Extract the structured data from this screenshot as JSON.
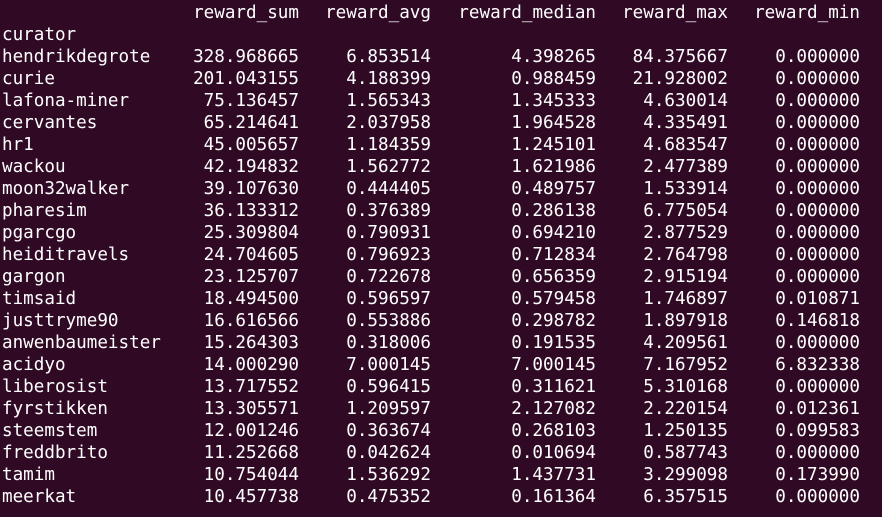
{
  "terminal": {
    "top_cut_text": "-----",
    "columns": [
      "reward_sum",
      "reward_avg",
      "reward_median",
      "reward_max",
      "reward_min"
    ],
    "index_name": "curator",
    "rows": [
      [
        "hendrikdegrote",
        "328.968665",
        "6.853514",
        "4.398265",
        "84.375667",
        "0.000000"
      ],
      [
        "curie",
        "201.043155",
        "4.188399",
        "0.988459",
        "21.928002",
        "0.000000"
      ],
      [
        "lafona-miner",
        "75.136457",
        "1.565343",
        "1.345333",
        "4.630014",
        "0.000000"
      ],
      [
        "cervantes",
        "65.214641",
        "2.037958",
        "1.964528",
        "4.335491",
        "0.000000"
      ],
      [
        "hr1",
        "45.005657",
        "1.184359",
        "1.245101",
        "4.683547",
        "0.000000"
      ],
      [
        "wackou",
        "42.194832",
        "1.562772",
        "1.621986",
        "2.477389",
        "0.000000"
      ],
      [
        "moon32walker",
        "39.107630",
        "0.444405",
        "0.489757",
        "1.533914",
        "0.000000"
      ],
      [
        "pharesim",
        "36.133312",
        "0.376389",
        "0.286138",
        "6.775054",
        "0.000000"
      ],
      [
        "pgarcgo",
        "25.309804",
        "0.790931",
        "0.694210",
        "2.877529",
        "0.000000"
      ],
      [
        "heiditravels",
        "24.704605",
        "0.796923",
        "0.712834",
        "2.764798",
        "0.000000"
      ],
      [
        "gargon",
        "23.125707",
        "0.722678",
        "0.656359",
        "2.915194",
        "0.000000"
      ],
      [
        "timsaid",
        "18.494500",
        "0.596597",
        "0.579458",
        "1.746897",
        "0.010871"
      ],
      [
        "justtryme90",
        "16.616566",
        "0.553886",
        "0.298782",
        "1.897918",
        "0.146818"
      ],
      [
        "anwenbaumeister",
        "15.264303",
        "0.318006",
        "0.191535",
        "4.209561",
        "0.000000"
      ],
      [
        "acidyo",
        "14.000290",
        "7.000145",
        "7.000145",
        "7.167952",
        "6.832338"
      ],
      [
        "liberosist",
        "13.717552",
        "0.596415",
        "0.311621",
        "5.310168",
        "0.000000"
      ],
      [
        "fyrstikken",
        "13.305571",
        "1.209597",
        "2.127082",
        "2.220154",
        "0.012361"
      ],
      [
        "steemstem",
        "12.001246",
        "0.363674",
        "0.268103",
        "1.250135",
        "0.099583"
      ],
      [
        "freddbrito",
        "11.252668",
        "0.042624",
        "0.010694",
        "0.587743",
        "0.000000"
      ],
      [
        "tamim",
        "10.754044",
        "1.536292",
        "1.437731",
        "3.299098",
        "0.173990"
      ],
      [
        "meerkat",
        "10.457738",
        "0.475352",
        "0.161364",
        "6.357515",
        "0.000000"
      ]
    ]
  }
}
